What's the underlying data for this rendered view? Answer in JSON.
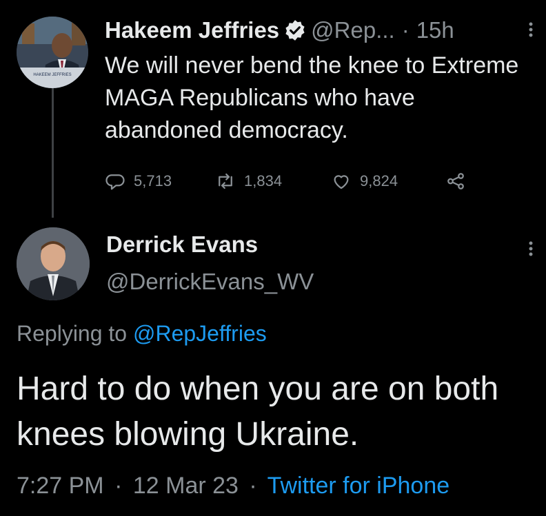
{
  "tweet1": {
    "name": "Hakeem Jeffries",
    "handle": "@Rep...",
    "separator": "·",
    "time": "15h",
    "text": "We will never bend the knee to Extreme MAGA Republicans who have abandoned democracy.",
    "replies": "5,713",
    "retweets": "1,834",
    "likes": "9,824",
    "avatar_caption": "HAKEEM JEFFRIES",
    "verified": true
  },
  "tweet2": {
    "name": "Derrick Evans",
    "handle": "@DerrickEvans_WV",
    "replying_prefix": "Replying to",
    "replying_to": "@RepJeffries",
    "text": "Hard to do when you are on both knees blowing Ukraine.",
    "time": "7:27 PM",
    "separator": "·",
    "date": "12 Mar 23",
    "source": "Twitter for iPhone"
  },
  "colors": {
    "background": "#000000",
    "text": "#e7e9ea",
    "muted": "#8b9196",
    "link": "#1d9bf0"
  },
  "icons": [
    "verified-badge-icon",
    "more-icon",
    "reply-icon",
    "retweet-icon",
    "like-icon",
    "share-icon"
  ]
}
